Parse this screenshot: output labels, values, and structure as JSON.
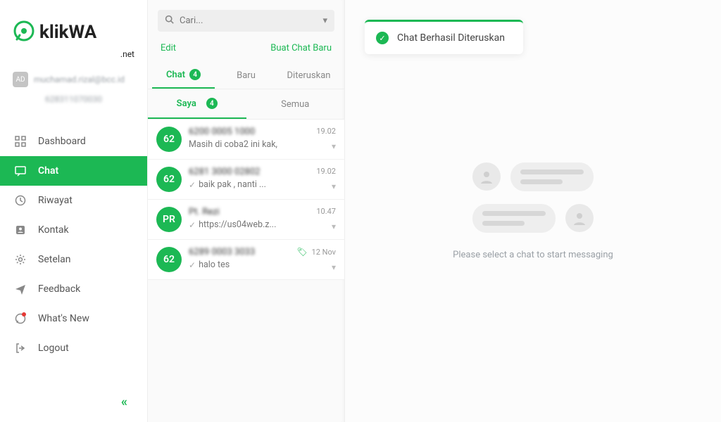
{
  "brand": {
    "name": "klikWA",
    "suffix": ".net"
  },
  "user": {
    "badge": "AD",
    "email": "muchamad.rizal@bcc.id",
    "phone": "628311070030"
  },
  "nav": {
    "items": [
      {
        "id": "dashboard",
        "label": "Dashboard"
      },
      {
        "id": "chat",
        "label": "Chat"
      },
      {
        "id": "riwayat",
        "label": "Riwayat"
      },
      {
        "id": "kontak",
        "label": "Kontak"
      },
      {
        "id": "setelan",
        "label": "Setelan"
      },
      {
        "id": "feedback",
        "label": "Feedback"
      },
      {
        "id": "whatsnew",
        "label": "What's New"
      },
      {
        "id": "logout",
        "label": "Logout"
      }
    ],
    "active": "chat"
  },
  "search": {
    "placeholder": "Cari..."
  },
  "toolbar": {
    "edit": "Edit",
    "new_chat": "Buat Chat Baru"
  },
  "tabs": {
    "items": [
      {
        "id": "chat",
        "label": "Chat",
        "badge": 4
      },
      {
        "id": "baru",
        "label": "Baru"
      },
      {
        "id": "diteruskan",
        "label": "Diteruskan"
      }
    ],
    "active": "chat"
  },
  "subtabs": {
    "items": [
      {
        "id": "saya",
        "label": "Saya",
        "badge": 4
      },
      {
        "id": "semua",
        "label": "Semua"
      }
    ],
    "active": "saya"
  },
  "threads": [
    {
      "avatar": "62",
      "title": "6200 0005 1000",
      "preview": "Masih di coba2 ini kak,",
      "time": "19.02",
      "sent": false,
      "tagged": false
    },
    {
      "avatar": "62",
      "title": "6281 3000 02802",
      "preview": "baik pak , nanti ...",
      "time": "19.02",
      "sent": true,
      "tagged": false
    },
    {
      "avatar": "PR",
      "title": "Pt. Rezi",
      "preview": "https://us04web.z...",
      "time": "10.47",
      "sent": true,
      "tagged": false
    },
    {
      "avatar": "62",
      "title": "6289 0003 3033",
      "preview": "halo tes",
      "time": "12 Nov",
      "sent": true,
      "tagged": true
    }
  ],
  "toast": {
    "text": "Chat Berhasil Diteruskan"
  },
  "empty": {
    "text": "Please select a chat to start messaging"
  }
}
